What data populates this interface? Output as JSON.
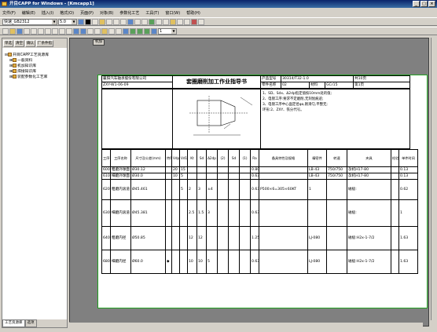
{
  "window": {
    "title": "开目CAPP for Windows - [Kmcapp1]",
    "buttons": [
      "_",
      "□",
      "×"
    ]
  },
  "menu": [
    "文件(F)",
    "编辑(E)",
    "插入(I)",
    "格式(O)",
    "页面(P)",
    "对象(B)",
    "参数化工艺",
    "工具(T)",
    "窗口(W)",
    "帮助(H)"
  ],
  "toolbar": {
    "style_select": "快速_GB2312",
    "size_select": "5.0",
    "zoom_select": "1"
  },
  "left_panel": {
    "buttons": [
      "单选",
      "清空",
      "确认",
      "厂条件指"
    ],
    "tree": [
      "开目CAPP工艺资源库",
      "一般资料",
      "机加知识库",
      "焊接知识库",
      "装配参数化工艺库"
    ],
    "tabs": [
      "工艺资源库",
      "选项"
    ]
  },
  "workspace_tab": "机加",
  "sheet": {
    "company": "襄阳汽车轴承股份有限公司",
    "doc_no": "ZXY-W1-06-09",
    "title": "套圈磨削加工作业指导书",
    "product_label": "产品型号",
    "product": "30314/T32-1.0",
    "part_label": "零件名称",
    "part": "02",
    "material_label": "材料",
    "material": "GCr15",
    "total_label": "共10页",
    "page_label": "第1页",
    "notes": [
      "1、SD、Sdx、Δ2dp指定值按10mm处的值;",
      "2、电镀工序:要求不定磨削,无刻划痕迹;",
      "3、电镀工序中心面定径φa,刚滑匀,平整无;",
      "   环形:2、ZXY、铁分代号。"
    ],
    "col_headers": [
      "工序号",
      "工序名称",
      "尺寸及公差(mm)",
      "特殊特性",
      "Vdp",
      "Vd1",
      "Kt",
      "Sd",
      "Δ2dp",
      "(2)",
      "Sd",
      "(1)",
      "Ra",
      "备具特性及规格",
      "精密件",
      "转速",
      "夹具",
      "检验器",
      "单件时间"
    ],
    "rows": [
      {
        "no": "600",
        "name": "粗磨外球面",
        "dim": "Ø30.12",
        "a": "20",
        "b": "15",
        "c": "",
        "d": "",
        "e": "",
        "ra": "0.80",
        "spec": "",
        "eq": "LB-43",
        "rpm": "750/750",
        "fix": "孕机H17-80",
        "t": "0.13"
      },
      {
        "no": "610",
        "name": "细磨外球面",
        "dim": "Ø30.0",
        "a": "10",
        "b": "5",
        "c": "",
        "d": "",
        "e": "",
        "ra": "0.63",
        "spec": "",
        "eq": "LB-43",
        "rpm": "750/750",
        "fix": "孕机H17-80",
        "t": "0.13"
      },
      {
        "no": "620",
        "name": "粗磨内滚道",
        "dim": "Ø45.461",
        "a": "",
        "b": "5",
        "c": "2",
        "d": "3",
        "e": "±4",
        "ra": "0.63",
        "spec": "P500×6=305×60KT",
        "eq": "1",
        "rpm": "",
        "fix": "磁极:",
        "t": "0.62"
      },
      {
        "no": "630",
        "name": "细磨内滚道",
        "dim": "Ø45.381",
        "a": "",
        "b": "",
        "c": "2.5",
        "d": "1.5",
        "e": "3",
        "ra": "0.63",
        "spec": "",
        "eq": "",
        "rpm": "",
        "fix": "磁极:",
        "t": "1"
      },
      {
        "no": "640",
        "name": "粗磨内径",
        "dim": "Ø50.85",
        "a": "",
        "b": "",
        "c": "12",
        "d": "12",
        "e": "",
        "ra": "1.25",
        "spec": "",
        "eq": "LJ-080",
        "rpm": "",
        "fix": "磁极:H2x-1-7/2",
        "t": "1.63"
      },
      {
        "no": "680",
        "name": "细磨内径",
        "dim": "Ø60.0",
        "a": "",
        "b": "",
        "c": "10",
        "d": "10",
        "e": "5",
        "ra": "0.63",
        "spec": "",
        "eq": "LJ-080",
        "rpm": "",
        "fix": "磁极:H2x-1-7/2",
        "t": "1.63"
      }
    ]
  }
}
